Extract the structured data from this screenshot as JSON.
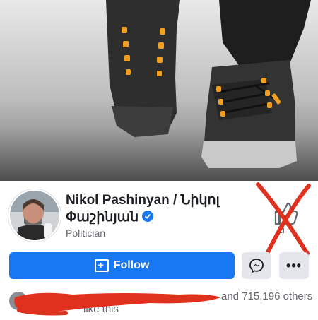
{
  "page": {
    "name": "Nikol Pashinyan / Նիկոլ Փաշինյան",
    "category": "Politician",
    "verified": true,
    "like_label": "Li",
    "follow_label": "Follow",
    "likes_suffix": "and 715,196 others",
    "likes_line2": "like this"
  },
  "icons": {
    "follow": "follow-icon",
    "messenger": "messenger-icon",
    "more": "more-icon",
    "like": "like-icon",
    "verified": "verified-badge-icon"
  },
  "colors": {
    "accent": "#1877f2",
    "cross": "#e0301e",
    "redaction": "#e0301e"
  }
}
